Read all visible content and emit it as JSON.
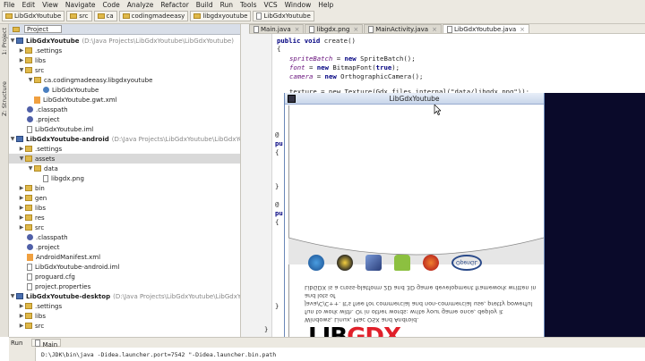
{
  "menu": [
    "File",
    "Edit",
    "View",
    "Navigate",
    "Code",
    "Analyze",
    "Refactor",
    "Build",
    "Run",
    "Tools",
    "VCS",
    "Window",
    "Help"
  ],
  "breadcrumbs": [
    "LibGdxYoutube",
    "src",
    "ca",
    "codingmadeeasy",
    "libgdxyoutube",
    "LibGdxYoutube"
  ],
  "left_tabs": {
    "project": "1: Project",
    "structure": "Z: Structure"
  },
  "project_panel": {
    "title": "Project"
  },
  "tree": [
    {
      "label": "LibGdxYoutube",
      "extra": "(D:\\Java Projects\\LibGdxYoutube\\LibGdxYoutube)"
    },
    {
      "label": ".settings"
    },
    {
      "label": "libs"
    },
    {
      "label": "src"
    },
    {
      "label": "ca.codingmadeeasy.libgdxyoutube"
    },
    {
      "label": "LibGdxYoutube"
    },
    {
      "label": "LibGdxYoutube.gwt.xml"
    },
    {
      "label": ".classpath"
    },
    {
      "label": ".project"
    },
    {
      "label": "LibGdxYoutube.iml"
    },
    {
      "label": "LibGdxYoutube-android",
      "extra": "(D:\\Java Projects\\LibGdxYoutube\\LibGdxYoutube-an"
    },
    {
      "label": ".settings"
    },
    {
      "label": "assets"
    },
    {
      "label": "data"
    },
    {
      "label": "libgdx.png"
    },
    {
      "label": "bin"
    },
    {
      "label": "gen"
    },
    {
      "label": "libs"
    },
    {
      "label": "res"
    },
    {
      "label": "src"
    },
    {
      "label": ".classpath"
    },
    {
      "label": ".project"
    },
    {
      "label": "AndroidManifest.xml"
    },
    {
      "label": "LibGdxYoutube-android.iml"
    },
    {
      "label": "proguard.cfg"
    },
    {
      "label": "project.properties"
    },
    {
      "label": "LibGdxYoutube-desktop",
      "extra": "(D:\\Java Projects\\LibGdxYoutube\\LibGdxYoutube-de"
    },
    {
      "label": ".settings"
    },
    {
      "label": "libs"
    },
    {
      "label": "src"
    }
  ],
  "editor_tabs": [
    "Main.java",
    "libgdx.png",
    "MainActivity.java",
    "LibGdxYoutube.java"
  ],
  "code": {
    "l1_kw": "public void ",
    "l1_rest": "create()",
    "l2": "{",
    "l3_it": "spriteBatch",
    "l3_a": " = ",
    "l3_kw": "new ",
    "l3_b": "SpriteBatch();",
    "l4_it": "font",
    "l4_a": " = ",
    "l4_kw": "new ",
    "l4_b": "BitmapFont(",
    "l4_kw2": "true",
    "l4_c": ");",
    "l5_it": "camera",
    "l5_a": " = ",
    "l5_kw": "new ",
    "l5_b": "OrthographicCamera();",
    "l6": "texture = new Texture(Gdx.files.internal(\"data/libgdx.png\"));",
    "frag_a": "@",
    "frag_pu": "pu",
    "frag_brace": "{",
    "frag_close": "}",
    "frag_b": "}",
    "frag_c": "}"
  },
  "app_window": {
    "title": "LibGdxYoutube",
    "splash_text": [
      "LibGDX is a cross-platform 2D and 3D game development framework written in",
      "Java/C/C++. It's free for commercial and non-commercial use, pretty powerful and lots of",
      "fun to work with. Or in other words: write your game once, deploy it",
      "Windows, Linux, Mac OSX and Android."
    ],
    "logo_text": "LIBGDX",
    "platforms": [
      "windows",
      "linux",
      "mac",
      "android",
      "java",
      "opengl"
    ],
    "opengl_label": "OpenGL"
  },
  "run_panel": {
    "label": "Run",
    "tab": "Main"
  },
  "console": {
    "line": "D:\\JDK\\bin\\java -Didea.launcher.port=7542 \"-Didea.launcher.bin.path"
  },
  "colors": {
    "accent": "#4a6fb0",
    "dark_panel": "#0a0a2a",
    "gdx_red": "#e0202a"
  }
}
